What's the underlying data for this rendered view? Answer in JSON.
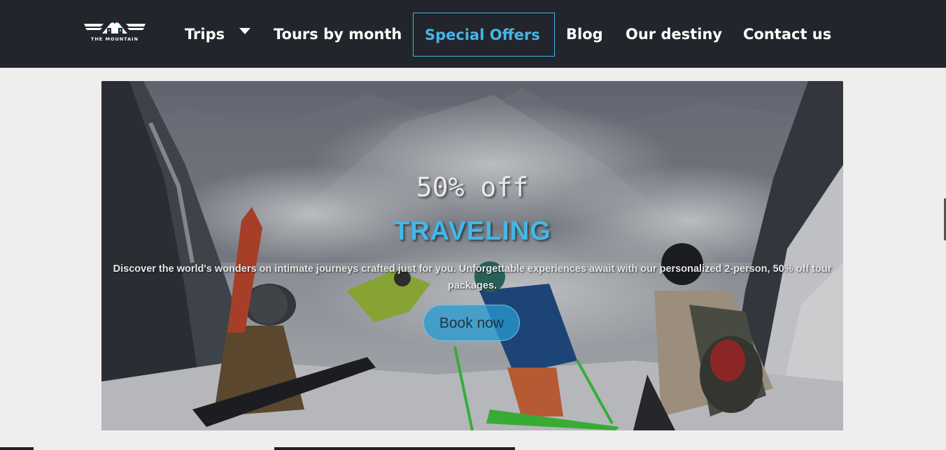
{
  "brand": {
    "logo_text": "THE MOUNTAIN",
    "icon": "mountain-logo-icon"
  },
  "nav": {
    "items": [
      {
        "label": "Trips",
        "has_dropdown": true
      },
      {
        "label": "Tours by month"
      },
      {
        "label": "Special Offers",
        "active": true
      },
      {
        "label": "Blog"
      },
      {
        "label": "Our destiny"
      },
      {
        "label": "Contact us"
      }
    ]
  },
  "hero": {
    "subtitle": "50% off",
    "title": "TRAVELING",
    "description": "Discover the world's wonders on intimate journeys crafted just for you. Unforgettable experiences await with our personalized 2-person, 50% off tour packages.",
    "button_label": "Book now"
  },
  "colors": {
    "topbar": "#22252b",
    "accent": "#45b6e7",
    "page_bg": "#efedee"
  }
}
